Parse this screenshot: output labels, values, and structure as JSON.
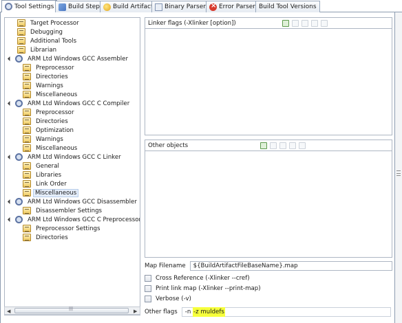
{
  "tabs": [
    {
      "label": "Tool Settings",
      "icon": "gear-icon",
      "active": true
    },
    {
      "label": "Build Steps",
      "icon": "build-steps-icon",
      "active": false
    },
    {
      "label": "Build Artifact",
      "icon": "build-artifact-icon",
      "active": false
    },
    {
      "label": "Binary Parsers",
      "icon": "binary-parsers-icon",
      "active": false
    },
    {
      "label": "Error Parsers",
      "icon": "error-icon",
      "active": false
    },
    {
      "label": "Build Tool Versions",
      "icon": "",
      "active": false
    }
  ],
  "tree": [
    {
      "label": "Target Processor",
      "kind": "option",
      "level": 1
    },
    {
      "label": "Debugging",
      "kind": "option",
      "level": 1
    },
    {
      "label": "Additional Tools",
      "kind": "option",
      "level": 1
    },
    {
      "label": "Librarian",
      "kind": "option",
      "level": 1
    },
    {
      "label": "ARM Ltd Windows GCC Assembler",
      "kind": "tool",
      "level": 0
    },
    {
      "label": "Preprocessor",
      "kind": "option",
      "level": 2
    },
    {
      "label": "Directories",
      "kind": "option",
      "level": 2
    },
    {
      "label": "Warnings",
      "kind": "option",
      "level": 2
    },
    {
      "label": "Miscellaneous",
      "kind": "option",
      "level": 2
    },
    {
      "label": "ARM Ltd Windows GCC C Compiler",
      "kind": "tool",
      "level": 0
    },
    {
      "label": "Preprocessor",
      "kind": "option",
      "level": 2
    },
    {
      "label": "Directories",
      "kind": "option",
      "level": 2
    },
    {
      "label": "Optimization",
      "kind": "option",
      "level": 2
    },
    {
      "label": "Warnings",
      "kind": "option",
      "level": 2
    },
    {
      "label": "Miscellaneous",
      "kind": "option",
      "level": 2
    },
    {
      "label": "ARM Ltd Windows GCC C Linker",
      "kind": "tool",
      "level": 0
    },
    {
      "label": "General",
      "kind": "option",
      "level": 2
    },
    {
      "label": "Libraries",
      "kind": "option",
      "level": 2
    },
    {
      "label": "Link Order",
      "kind": "option",
      "level": 2
    },
    {
      "label": "Miscellaneous",
      "kind": "option",
      "level": 2,
      "selected": true
    },
    {
      "label": "ARM Ltd Windows GCC Disassembler",
      "kind": "tool",
      "level": 0
    },
    {
      "label": "Disassembler Settings",
      "kind": "option",
      "level": 2
    },
    {
      "label": "ARM Ltd Windows GCC C Preprocessor",
      "kind": "tool",
      "level": 0
    },
    {
      "label": "Preprocessor Settings",
      "kind": "option",
      "level": 2
    },
    {
      "label": "Directories",
      "kind": "option",
      "level": 2
    }
  ],
  "linker_flags": {
    "title": "Linker flags (-Xlinker [option])"
  },
  "other_objects": {
    "title": "Other objects"
  },
  "map_filename": {
    "label": "Map Filename",
    "value": "${BuildArtifactFileBaseName}.map"
  },
  "checkboxes": [
    {
      "label": "Cross Reference (-Xlinker --cref)",
      "checked": false
    },
    {
      "label": "Print link map (-Xlinker --print-map)",
      "checked": false
    },
    {
      "label": "Verbose (-v)",
      "checked": false
    }
  ],
  "other_flags": {
    "label": "Other flags",
    "value_plain": "-n ",
    "value_highlighted": "-z muldefs"
  },
  "colors": {
    "highlight": "#f6ff3c",
    "selection": "#e5eefb"
  }
}
